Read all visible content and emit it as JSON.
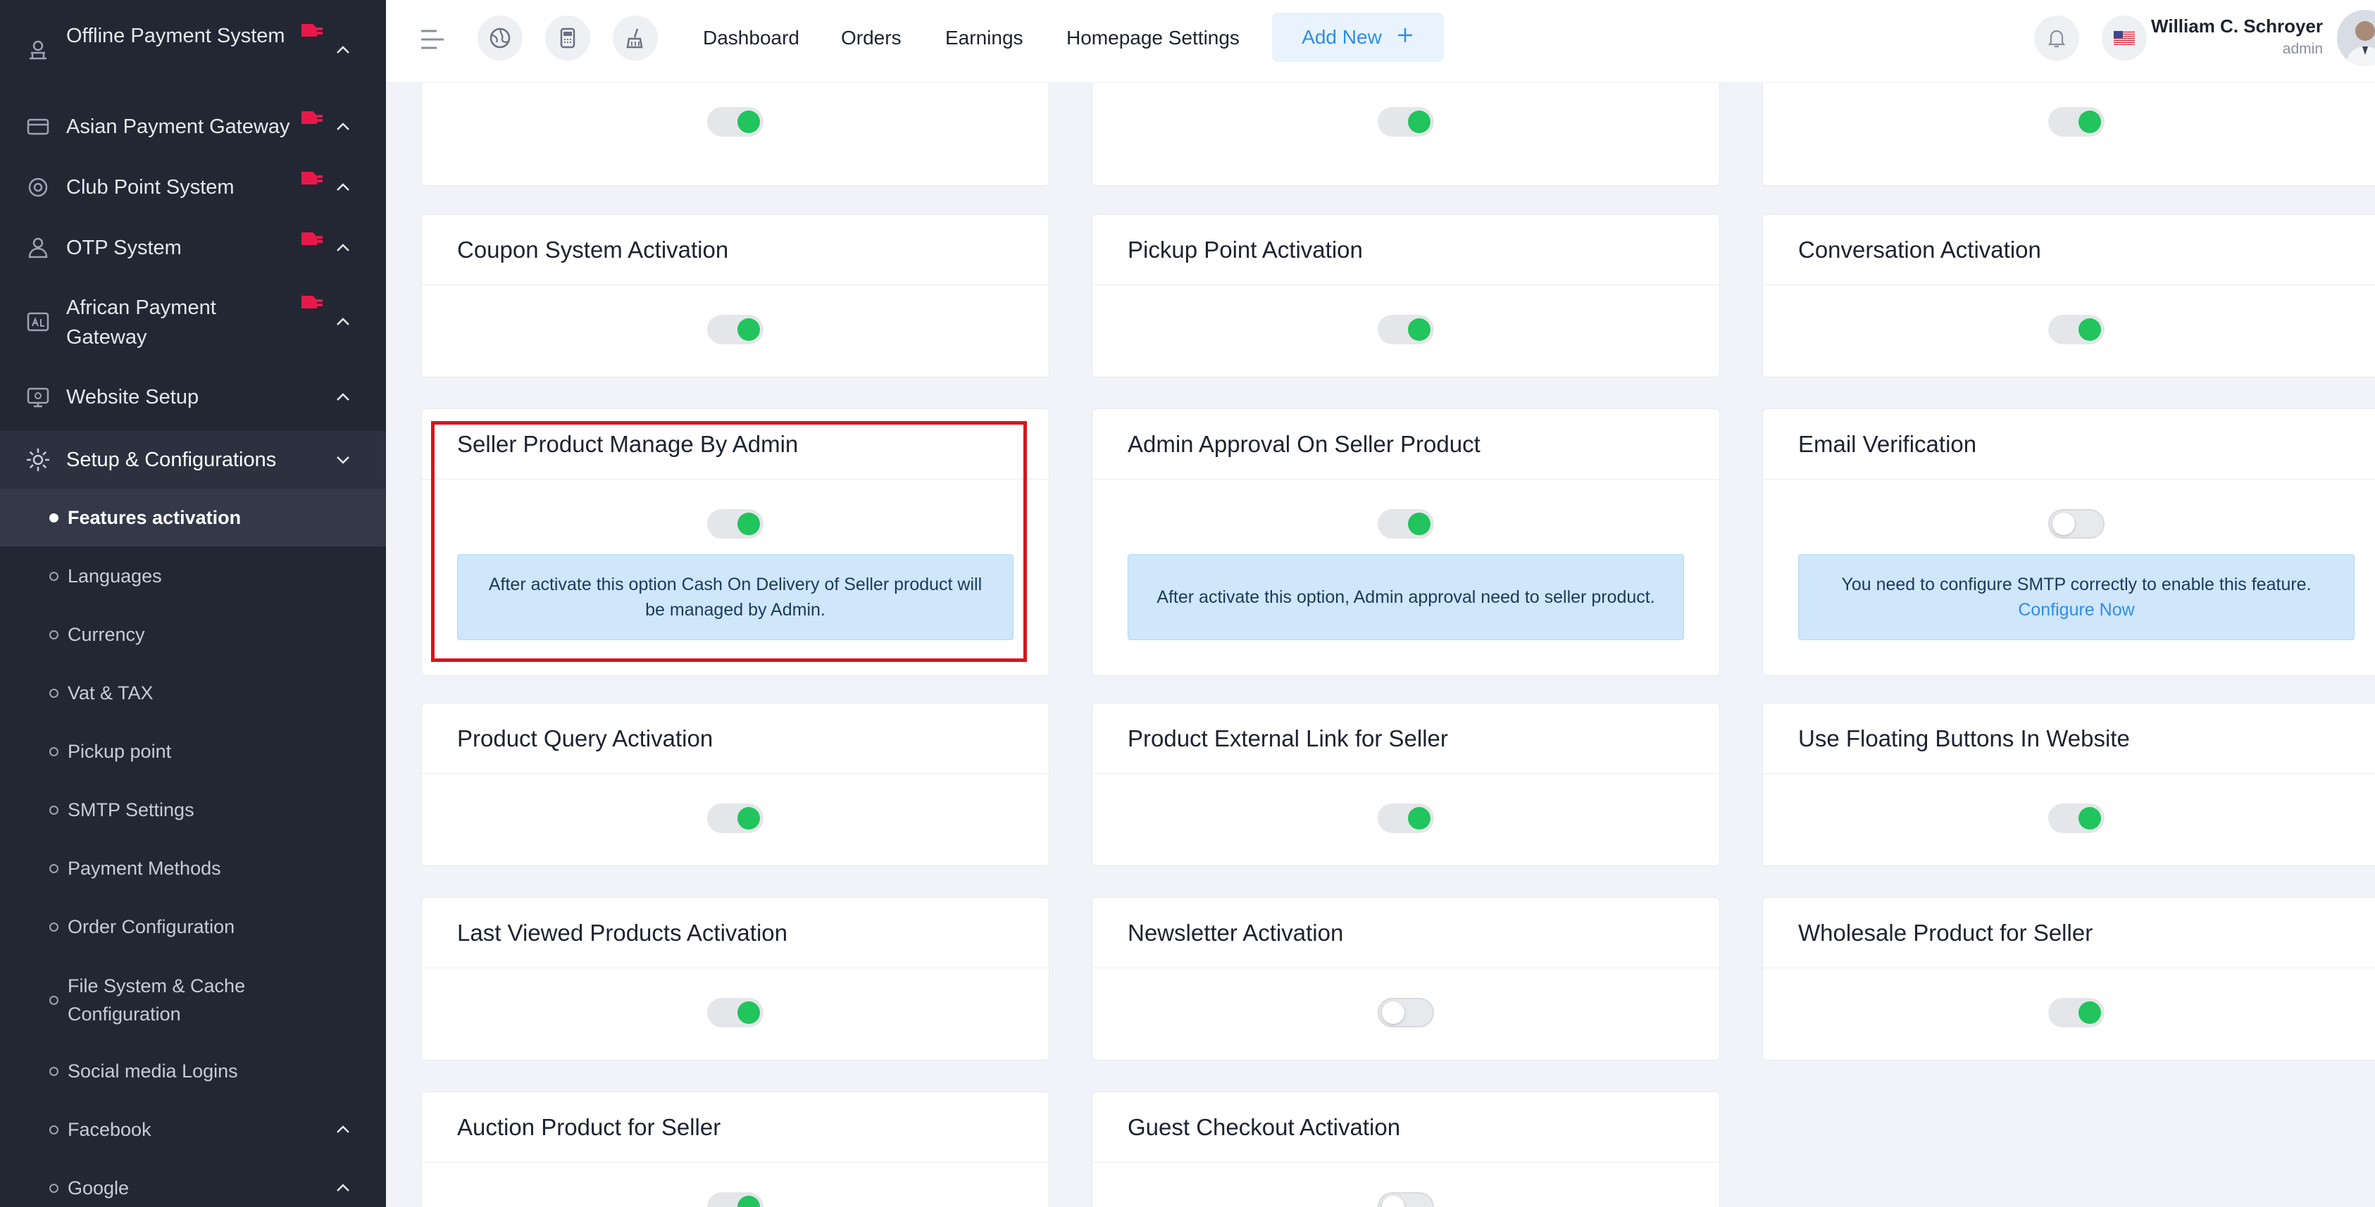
{
  "sidebar": {
    "menu": [
      {
        "label": "Offline Payment System",
        "icon": "bank-icon",
        "addon": true
      },
      {
        "label": "Asian Payment Gateway",
        "icon": "payment-gateway-icon",
        "addon": true
      },
      {
        "label": "Club Point System",
        "icon": "club-point-icon",
        "addon": true
      },
      {
        "label": "OTP System",
        "icon": "otp-icon",
        "addon": true
      },
      {
        "label": "African Payment Gateway",
        "icon": "african-gateway-icon",
        "addon": true
      },
      {
        "label": "Website Setup",
        "icon": "website-icon",
        "addon": false
      },
      {
        "label": "Setup & Configurations",
        "icon": "gear-icon",
        "addon": false
      }
    ],
    "submenu": [
      {
        "label": "Features activation"
      },
      {
        "label": "Languages"
      },
      {
        "label": "Currency"
      },
      {
        "label": "Vat & TAX"
      },
      {
        "label": "Pickup point"
      },
      {
        "label": "SMTP Settings"
      },
      {
        "label": "Payment Methods"
      },
      {
        "label": "Order Configuration"
      },
      {
        "label": "File System & Cache Configuration"
      },
      {
        "label": "Social media Logins"
      },
      {
        "label": "Facebook"
      },
      {
        "label": "Google"
      }
    ]
  },
  "topbar": {
    "nav": [
      "Dashboard",
      "Orders",
      "Earnings",
      "Homepage Settings"
    ],
    "add_new": "Add New",
    "user_name": "William C. Schroyer",
    "user_role": "admin"
  },
  "cards": {
    "top_row": [
      {
        "enabled": true
      },
      {
        "enabled": true
      },
      {
        "enabled": true
      }
    ],
    "coupon": {
      "title": "Coupon System Activation",
      "enabled": true
    },
    "pickup": {
      "title": "Pickup Point Activation",
      "enabled": true
    },
    "conversation": {
      "title": "Conversation Activation",
      "enabled": true
    },
    "seller_manage": {
      "title": "Seller Product Manage By Admin",
      "enabled": true,
      "info": "After activate this option Cash On Delivery of Seller product will be managed by Admin."
    },
    "admin_approval": {
      "title": "Admin Approval On Seller Product",
      "enabled": true,
      "info": "After activate this option, Admin approval need to seller product."
    },
    "email_verification": {
      "title": "Email Verification",
      "enabled": false,
      "info": "You need to configure SMTP correctly to enable this feature.",
      "link": "Configure Now"
    },
    "product_query": {
      "title": "Product Query Activation",
      "enabled": true
    },
    "external_link": {
      "title": "Product External Link for Seller",
      "enabled": true
    },
    "floating_buttons": {
      "title": "Use Floating Buttons In Website",
      "enabled": true
    },
    "last_viewed": {
      "title": "Last Viewed Products Activation",
      "enabled": true
    },
    "newsletter": {
      "title": "Newsletter Activation",
      "enabled": false
    },
    "wholesale": {
      "title": "Wholesale Product for Seller",
      "enabled": true
    },
    "auction": {
      "title": "Auction Product for Seller",
      "enabled": true
    },
    "guest_checkout": {
      "title": "Guest Checkout Activation",
      "enabled": false
    }
  },
  "colors": {
    "sidebar_bg": "#232734",
    "toggle_on": "#21c45d",
    "accent": "#2f8ee6",
    "highlight": "#d8151c",
    "addon_badge": "#e8194a"
  }
}
